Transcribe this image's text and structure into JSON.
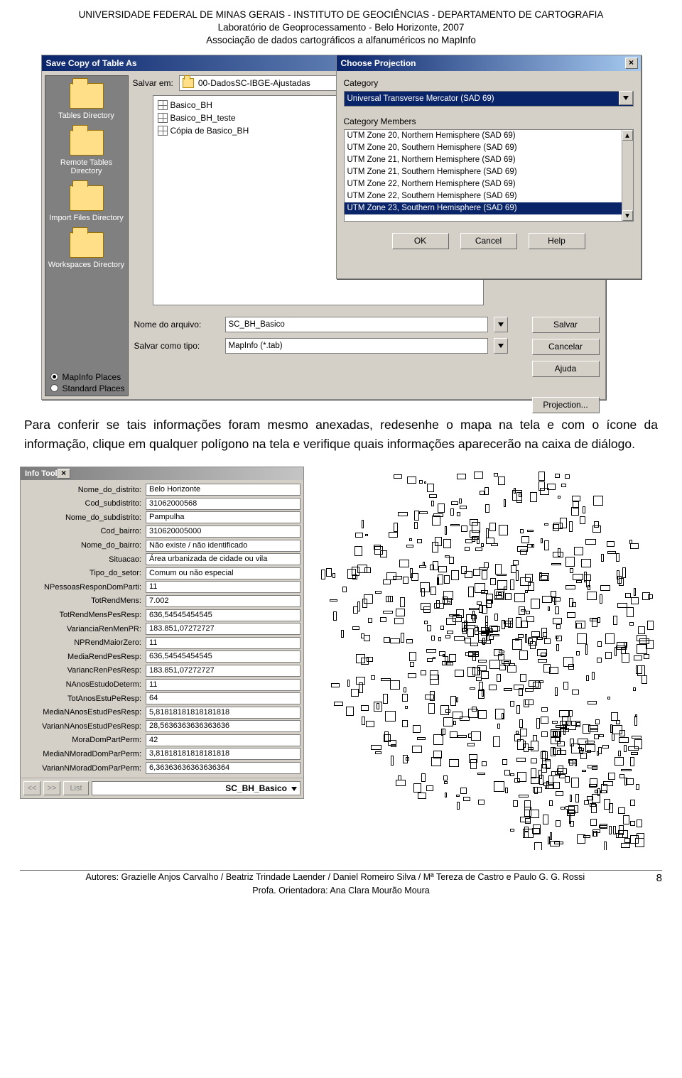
{
  "header": {
    "line1": "UNIVERSIDADE FEDERAL DE MINAS GERAIS - INSTITUTO DE GEOCIÊNCIAS - DEPARTAMENTO DE CARTOGRAFIA",
    "line2": "Laboratório de Geoprocessamento - Belo Horizonte, 2007",
    "line3": "Associação de dados cartográficos a alfanuméricos no MapInfo"
  },
  "save_dialog": {
    "title": "Save Copy of Table As",
    "salvar_em_label": "Salvar em:",
    "salvar_em_value": "00-DadosSC-IBGE-Ajustadas",
    "sidebar": {
      "items": [
        "Tables Directory",
        "Remote Tables Directory",
        "Import Files Directory",
        "Workspaces Directory"
      ]
    },
    "files": [
      "Basico_BH",
      "Basico_BH_teste",
      "Cópia de Basico_BH"
    ],
    "nome_label": "Nome do arquivo:",
    "nome_value": "SC_BH_Basico",
    "tipo_label": "Salvar como tipo:",
    "tipo_value": "MapInfo (*.tab)",
    "buttons": {
      "salvar": "Salvar",
      "cancelar": "Cancelar",
      "ajuda": "Ajuda",
      "projection": "Projection..."
    },
    "radios": {
      "mapinfo_places": "MapInfo Places",
      "standard_places": "Standard Places"
    }
  },
  "projection_dialog": {
    "title": "Choose Projection",
    "category_label": "Category",
    "category_value": "Universal Transverse Mercator (SAD 69)",
    "members_label": "Category Members",
    "members": [
      "UTM Zone 20, Northern Hemisphere (SAD 69)",
      "UTM Zone 20, Southern Hemisphere (SAD 69)",
      "UTM Zone 21, Northern Hemisphere (SAD 69)",
      "UTM Zone 21, Southern Hemisphere (SAD 69)",
      "UTM Zone 22, Northern Hemisphere (SAD 69)",
      "UTM Zone 22, Southern Hemisphere (SAD 69)",
      "UTM Zone 23, Southern Hemisphere (SAD 69)"
    ],
    "selected_index": 6,
    "buttons": {
      "ok": "OK",
      "cancel": "Cancel",
      "help": "Help"
    }
  },
  "paragraph": "Para conferir se tais informações foram mesmo anexadas, redesenhe o mapa na tela e com o ícone da informação, clique em qualquer polígono na tela e verifique quais informações aparecerão na caixa de diálogo.",
  "info_tool": {
    "title": "Info Tool",
    "rows": [
      {
        "label": "Nome_do_distrito:",
        "value": "Belo Horizonte"
      },
      {
        "label": "Cod_subdistrito:",
        "value": "31062000568"
      },
      {
        "label": "Nome_do_subdistrito:",
        "value": "Pampulha"
      },
      {
        "label": "Cod_bairro:",
        "value": "310620005000"
      },
      {
        "label": "Nome_do_bairro:",
        "value": "Não existe / não identificado"
      },
      {
        "label": "Situacao:",
        "value": "Área urbanizada de cidade ou vila"
      },
      {
        "label": "Tipo_do_setor:",
        "value": "Comum ou não especial"
      },
      {
        "label": "NPessoasResponDomParti:",
        "value": "11"
      },
      {
        "label": "TotRendMens:",
        "value": "7.002"
      },
      {
        "label": "TotRendMensPesResp:",
        "value": "636,54545454545"
      },
      {
        "label": "VarianciaRenMenPR:",
        "value": "183.851,07272727"
      },
      {
        "label": "NPRendMaiorZero:",
        "value": "11"
      },
      {
        "label": "MediaRendPesResp:",
        "value": "636,54545454545"
      },
      {
        "label": "VariancRenPesResp:",
        "value": "183.851,07272727"
      },
      {
        "label": "NAnosEstudoDeterm:",
        "value": "11"
      },
      {
        "label": "TotAnosEstuPeResp:",
        "value": "64"
      },
      {
        "label": "MediaNAnosEstudPesResp:",
        "value": "5,81818181818181818"
      },
      {
        "label": "VarianNAnosEstudPesResp:",
        "value": "28,5636363636363636"
      },
      {
        "label": "MoraDomPartPerm:",
        "value": "42"
      },
      {
        "label": "MediaNMoradDomParPerm:",
        "value": "3,81818181818181818"
      },
      {
        "label": "VarianNMoradDomParPerm:",
        "value": "6,36363636363636364"
      }
    ],
    "nav": {
      "prev": "<<",
      "next": ">>",
      "list": "List"
    },
    "footer_value": "SC_BH_Basico"
  },
  "footer": {
    "authors": "Autores: Grazielle Anjos Carvalho / Beatriz Trindade Laender / Daniel Romeiro Silva / Mª Tereza de Castro e Paulo G. G. Rossi",
    "prof": "Profa. Orientadora: Ana Clara Mourão Moura",
    "page": "8"
  }
}
